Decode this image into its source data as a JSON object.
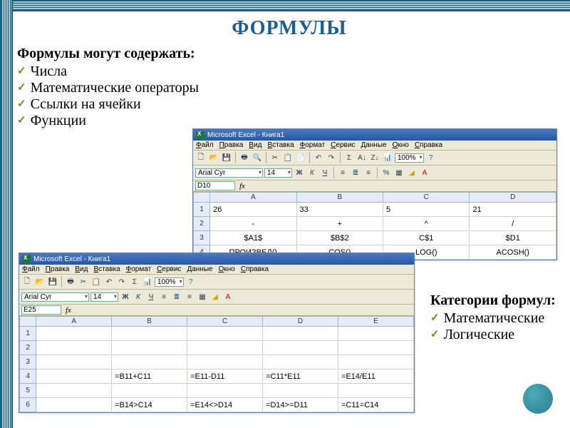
{
  "slide": {
    "title": "ФОРМУЛЫ",
    "intro": "Формулы могут содержать:",
    "bullets": [
      "Числа",
      "Математические операторы",
      "Ссылки на ячейки",
      "Функции"
    ],
    "categories_title": "Категории формул:",
    "categories": [
      "Математические",
      "Логические"
    ]
  },
  "excel_common": {
    "title": "Microsoft Excel - Книга1",
    "menu": [
      "Файл",
      "Правка",
      "Вид",
      "Вставка",
      "Формат",
      "Сервис",
      "Данные",
      "Окно",
      "Справка"
    ],
    "font": "Arial Cyr",
    "font_size": "14",
    "zoom": "100%"
  },
  "excel1": {
    "name_box": "D10",
    "columns": [
      "A",
      "B",
      "C",
      "D"
    ],
    "rows": [
      {
        "n": "1",
        "cells": [
          "26",
          "33",
          "5",
          "21"
        ]
      },
      {
        "n": "2",
        "cells": [
          "-",
          "+",
          "^",
          "/"
        ]
      },
      {
        "n": "3",
        "cells": [
          "$A1$",
          "$B$2",
          "C$1",
          "$D1"
        ]
      },
      {
        "n": "4",
        "cells": [
          "ПРОИЗВЕД()",
          "COS()",
          "LOG()",
          "ACOSH()"
        ]
      }
    ]
  },
  "excel2": {
    "name_box": "E25",
    "columns": [
      "A",
      "B",
      "C",
      "D",
      "E"
    ],
    "rows": [
      {
        "n": "1",
        "cells": [
          "",
          "",
          "",
          "",
          ""
        ]
      },
      {
        "n": "2",
        "cells": [
          "",
          "",
          "",
          "",
          ""
        ]
      },
      {
        "n": "3",
        "cells": [
          "",
          "",
          "",
          "",
          ""
        ]
      },
      {
        "n": "4",
        "cells": [
          "",
          "=B11+C11",
          "=E11-D11",
          "=C11*E11",
          "=E14/E11"
        ]
      },
      {
        "n": "5",
        "cells": [
          "",
          "",
          "",
          "",
          ""
        ]
      },
      {
        "n": "6",
        "cells": [
          "",
          "=B14>C14",
          "=E14<>D14",
          "=D14>=D11",
          "=C11=C14"
        ]
      }
    ]
  }
}
